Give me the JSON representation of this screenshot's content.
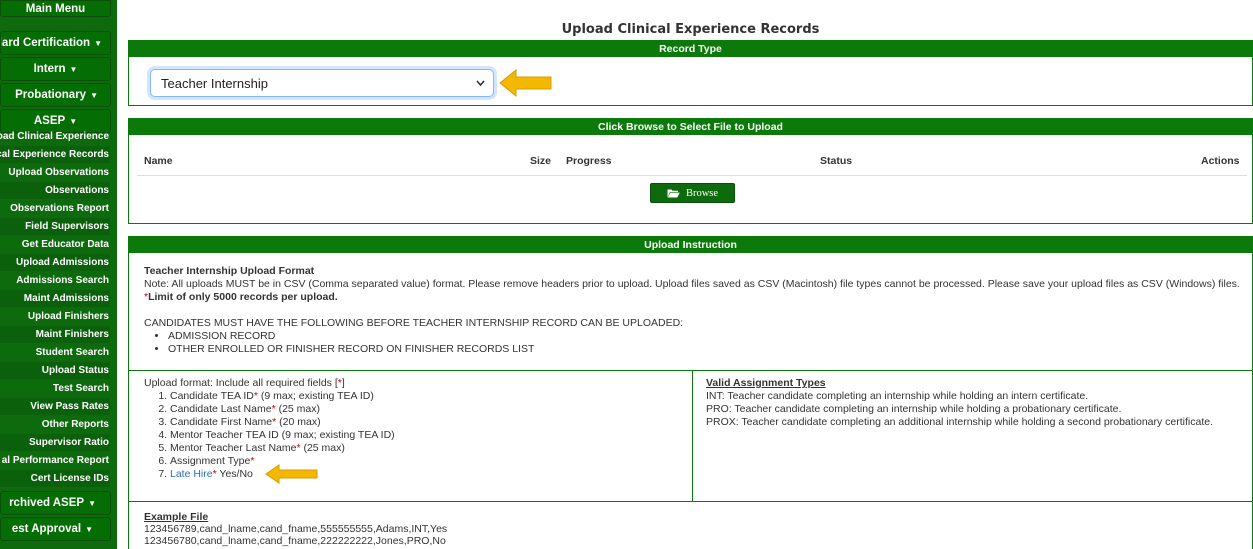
{
  "sidebar": {
    "main_menu": "Main Menu",
    "groups": [
      {
        "label": "dard Certification",
        "caret": "▼"
      },
      {
        "label": "Intern",
        "caret": "▼"
      },
      {
        "label": "Probationary",
        "caret": "▼"
      },
      {
        "label": "ASEP",
        "caret": "▼"
      }
    ],
    "items": [
      "oad Clinical Experience",
      "cal Experience Records",
      "Upload Observations",
      "Observations",
      "Observations Report",
      "Field Supervisors",
      "Get Educator Data",
      "Upload Admissions",
      "Admissions Search",
      "Maint Admissions",
      "Upload Finishers",
      "Maint Finishers",
      "Student Search",
      "Upload Status",
      "Test Search",
      "View Pass Rates",
      "Other Reports",
      "Supervisor Ratio",
      "al Performance Report",
      "Cert License IDs"
    ],
    "bottom_groups": [
      {
        "label": "rchived ASEP",
        "caret": "▼"
      },
      {
        "label": "est Approval",
        "caret": "▼"
      }
    ]
  },
  "page": {
    "title": "Upload Clinical Experience Records"
  },
  "record_type": {
    "heading": "Record Type",
    "selected": "Teacher Internship"
  },
  "upload": {
    "heading": "Click Browse to Select File to Upload",
    "columns": {
      "name": "Name",
      "size": "Size",
      "progress": "Progress",
      "status": "Status",
      "actions": "Actions"
    },
    "browse_label": "Browse"
  },
  "instructions": {
    "heading": "Upload Instruction",
    "format_title": "Teacher Internship Upload Format",
    "note": "Note: All uploads MUST be in CSV (Comma separated value) format. Please remove headers prior to upload. Upload files saved as CSV (Macintosh) file types cannot be processed. Please save your upload files as CSV (Windows) files.",
    "limit_star": "*",
    "limit": "Limit of only 5000 records per upload.",
    "prereq_title": "CANDIDATES MUST HAVE THE FOLLOWING BEFORE TEACHER INTERNSHIP RECORD CAN BE UPLOADED:",
    "prereqs": [
      "ADMISSION RECORD",
      "OTHER ENROLLED OR FINISHER RECORD ON FINISHER RECORDS LIST"
    ],
    "upload_format_prefix": "Upload format: Include all required fields [",
    "upload_format_star": "*",
    "upload_format_suffix": "]",
    "fields": [
      {
        "name": "Candidate TEA ID",
        "required": "*",
        "note": " (9 max; existing TEA ID)",
        "link": false
      },
      {
        "name": "Candidate Last Name",
        "required": "*",
        "note": " (25 max)",
        "link": false
      },
      {
        "name": "Candidate First Name",
        "required": "*",
        "note": " (20 max)",
        "link": false
      },
      {
        "name": "Mentor Teacher TEA ID (9 max; existing TEA ID)",
        "required": "",
        "note": "",
        "link": false
      },
      {
        "name": "Mentor Teacher Last Name",
        "required": "*",
        "note": " (25 max)",
        "link": false
      },
      {
        "name": "Assignment Type",
        "required": "*",
        "note": "",
        "link": false
      },
      {
        "name": "Late Hire",
        "required": "*",
        "note": " Yes/No",
        "link": true
      }
    ],
    "valid_title": "Valid Assignment Types",
    "valid_types": [
      "INT: Teacher candidate completing an internship while holding an intern certificate.",
      "PRO: Teacher candidate completing an internship while holding a probationary certificate.",
      "PROX: Teacher candidate completing an additional internship while holding a second probationary certificate."
    ],
    "example_title": "Example File",
    "example_lines": [
      "123456789,cand_lname,cand_fname,555555555,Adams,INT,Yes",
      "123456780,cand_lname,cand_fname,222222222,Jones,PRO,No"
    ]
  },
  "colors": {
    "sidebar": "#0d6b0d",
    "header_green": "#0b7a0b",
    "arrow": "#f5b800",
    "required": "#cc0000",
    "link": "#2a6fbd"
  }
}
